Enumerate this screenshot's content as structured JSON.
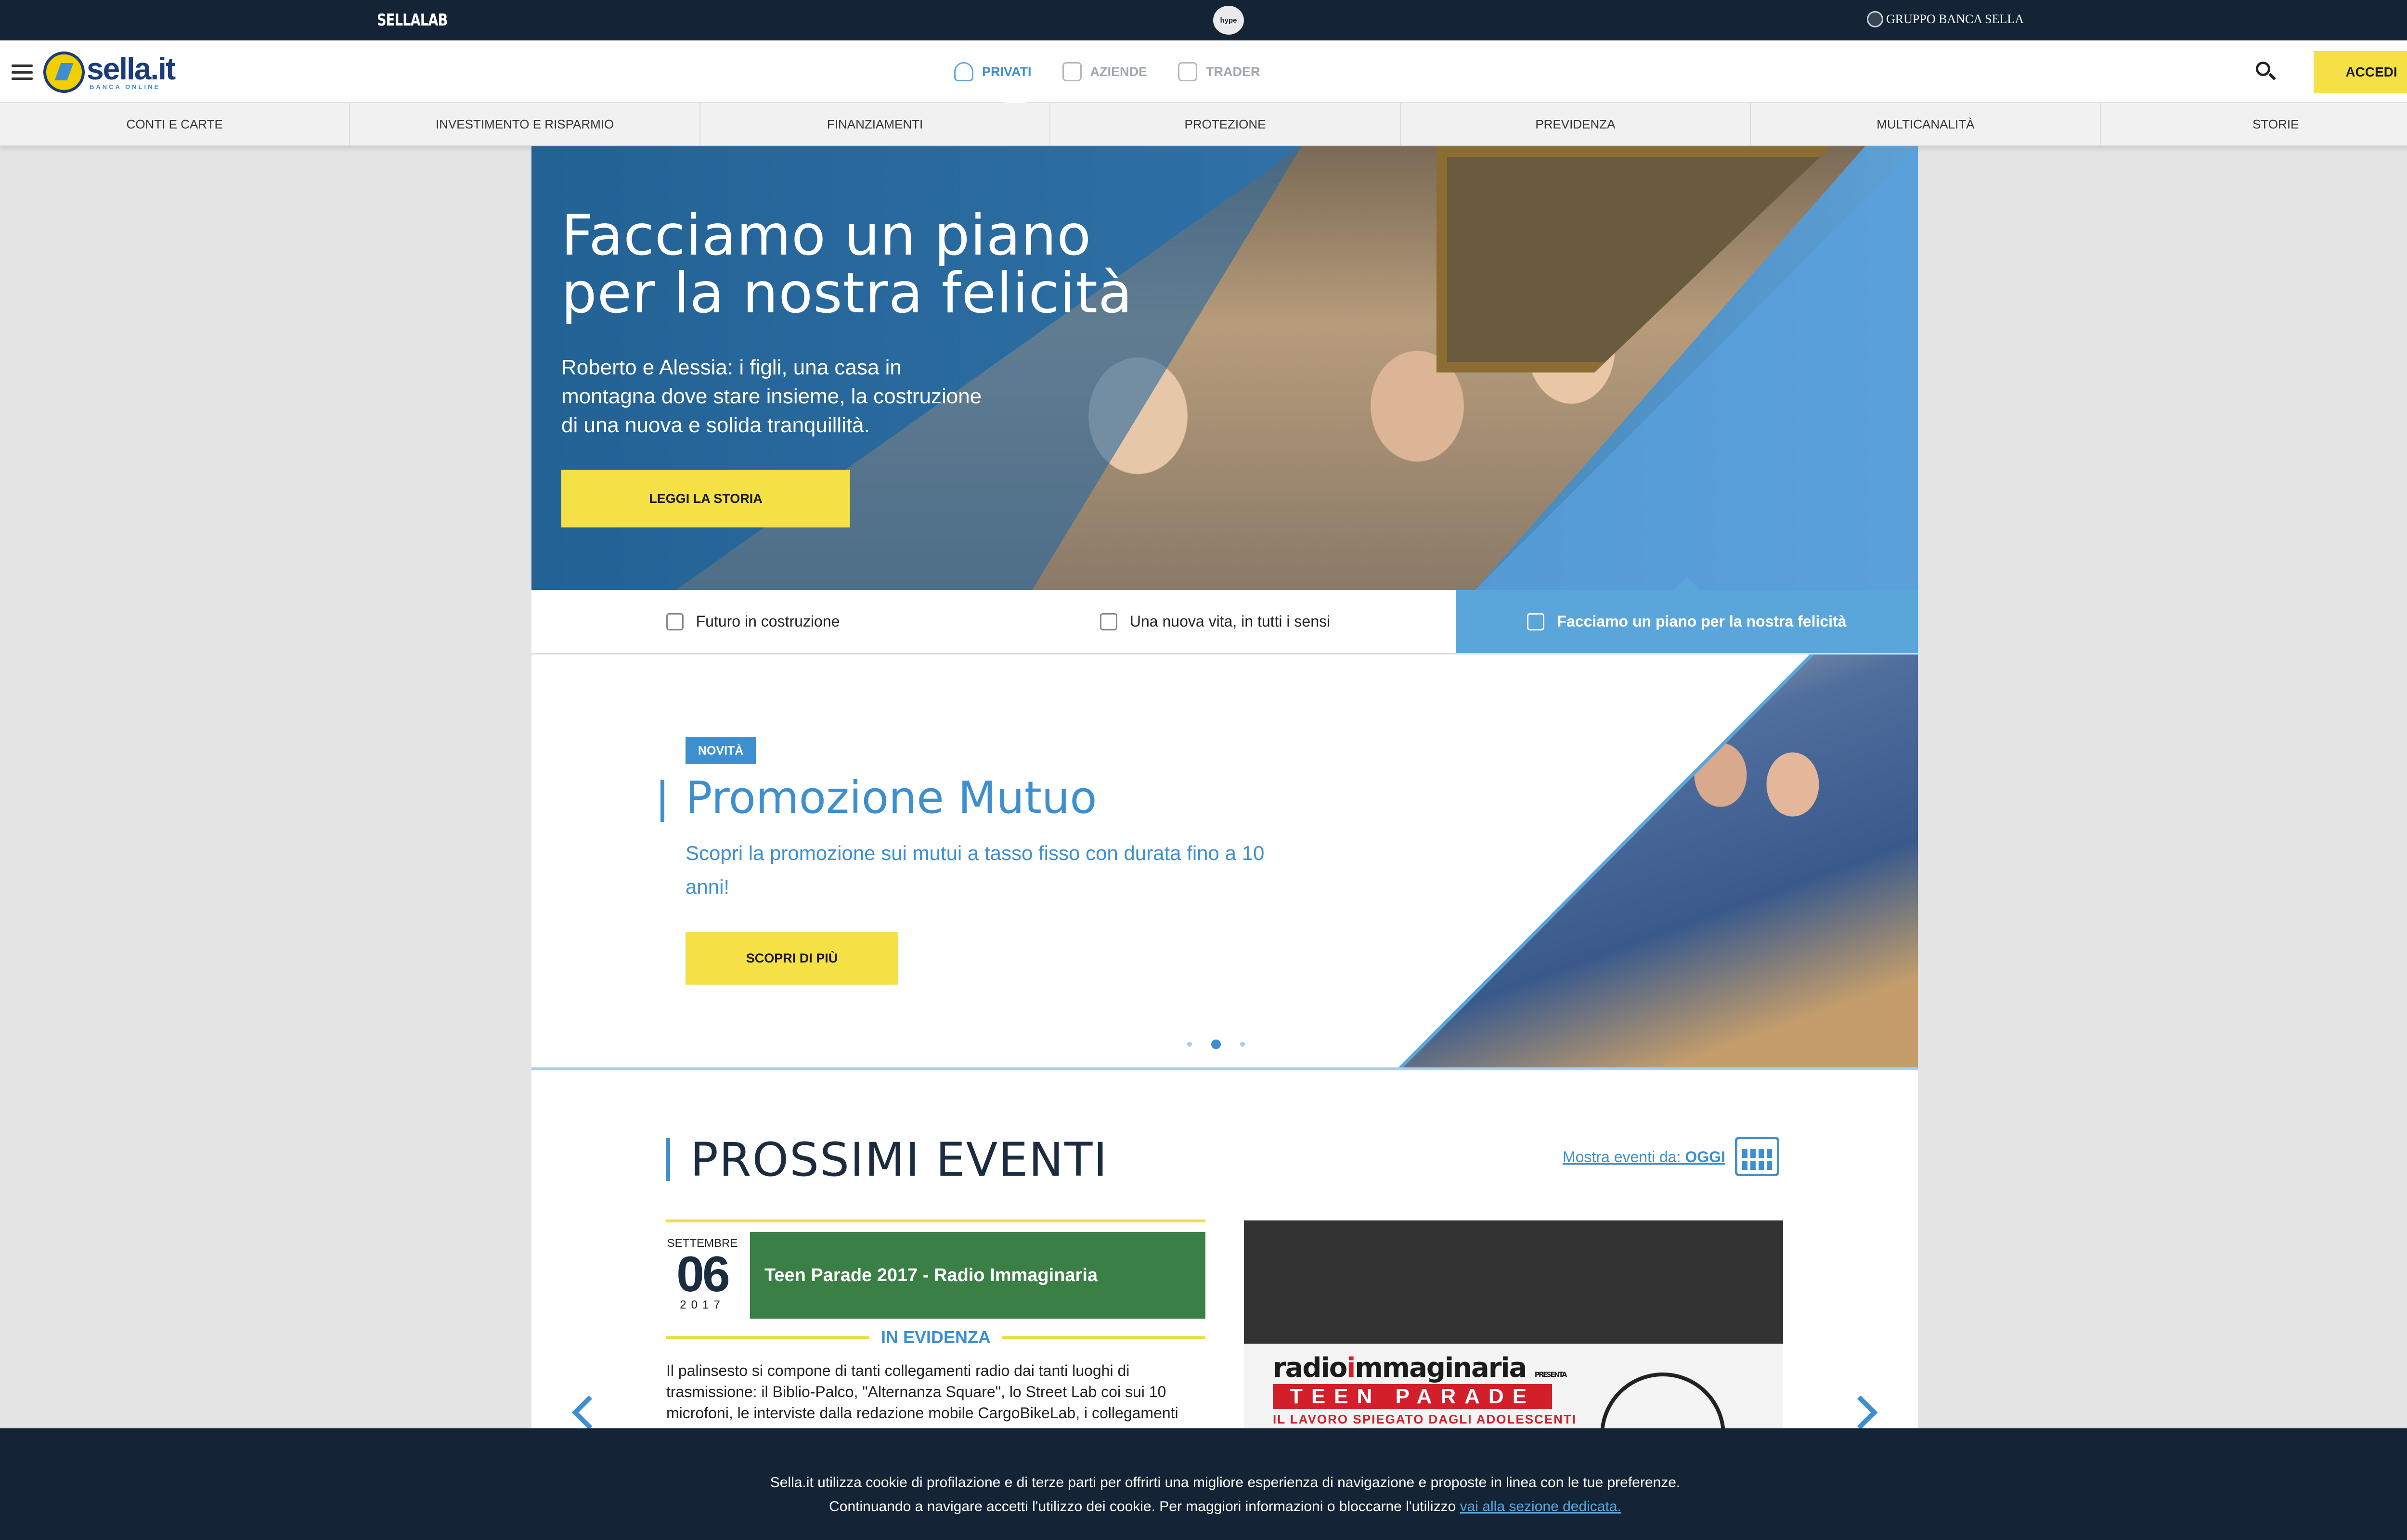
{
  "topbar": {
    "sellalab": "SELLALAB",
    "hype": "hype",
    "gruppo": "GRUPPO BANCA SELLA"
  },
  "header": {
    "brand": "sella.it",
    "brand_sub": "BANCA ONLINE",
    "tabs": [
      {
        "label": "PRIVATI",
        "active": true
      },
      {
        "label": "AZIENDE",
        "active": false
      },
      {
        "label": "TRADER",
        "active": false
      }
    ],
    "accedi": "ACCEDI",
    "icons": {
      "menu": "hamburger-icon",
      "search": "search-icon"
    }
  },
  "categories": [
    "CONTI E CARTE",
    "INVESTIMENTO E RISPARMIO",
    "FINANZIAMENTI",
    "PROTEZIONE",
    "PREVIDENZA",
    "MULTICANALITÀ",
    "STORIE"
  ],
  "hero": {
    "title": "Facciamo un piano per la nostra felicità",
    "text": "Roberto e Alessia: i figli, una casa in montagna dove stare insieme, la costruzione di una nuova e solida tranquillità.",
    "cta": "LEGGI LA STORIA"
  },
  "story_tabs": [
    {
      "label": "Futuro in costruzione",
      "icon": "hammer-icon",
      "active": false
    },
    {
      "label": "Una nuova vita, in tutti i sensi",
      "icon": "baby-icon",
      "active": false
    },
    {
      "label": "Facciamo un piano per la nostra felicità",
      "icon": "house-icon",
      "active": true
    }
  ],
  "promo": {
    "badge": "NOVITÀ",
    "title": "Promozione Mutuo",
    "text": "Scopri la promozione sui mutui a tasso fisso con durata fino a 10 anni!",
    "cta": "SCOPRI DI PIÙ",
    "slide_index": 2,
    "slide_count": 3
  },
  "events": {
    "title": "PROSSIMI EVENTI",
    "filter_label": "Mostra eventi da:",
    "filter_value": "OGGI",
    "event": {
      "month": "SETTEMBRE",
      "day": "06",
      "year": "2017",
      "title": "Teen Parade 2017 - Radio Immaginaria",
      "tag": "IN EVIDENZA",
      "description": "Il palinsesto si compone di tanti collegamenti radio dai tanti luoghi di trasmissione: il Biblio-Palco, \"Alternanza Square\", lo Street Lab coi sui 10 microfoni, le interviste dalla redazione mobile CargoBikeLab, i collegamenti"
    },
    "image": {
      "brand_a": "radio",
      "brand_b": "i",
      "brand_c": "mmaginaria",
      "presenta": "PRESENTA",
      "teen": "TEEN PARADE",
      "tagline": "IL LAVORO SPIEGATO DAGLI ADOLESCENTI"
    }
  },
  "cookie": {
    "line1": "Sella.it utilizza cookie di profilazione e di terze parti per offrirti una migliore esperienza di navigazione e proposte in linea con le tue preferenze.",
    "line2": "Continuando a navigare accetti l'utilizzo dei cookie. Per maggiori informazioni o bloccarne l'utilizzo",
    "link": "vai alla sezione dedicata."
  },
  "colors": {
    "accent": "#3d8fcf",
    "cta": "#f5e046",
    "dark": "#142436",
    "event_green": "#3a7f45"
  }
}
